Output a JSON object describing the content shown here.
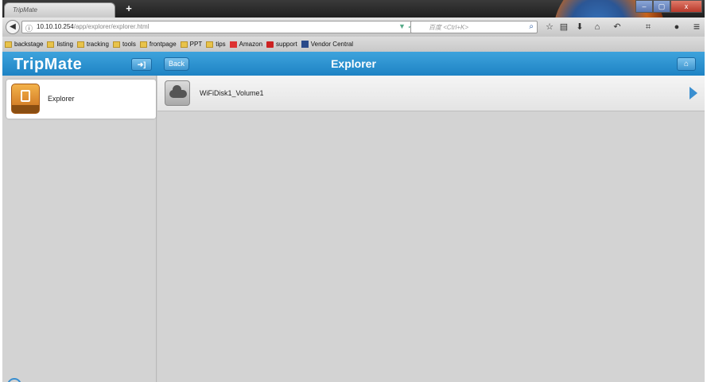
{
  "browser": {
    "tab_title": "TripMate",
    "new_tab_label": "+",
    "url_host": "10.10.10.254",
    "url_path": "/app/explorer/explorer.html",
    "search_placeholder": "百度 <Ctrl+K>",
    "window_buttons": [
      "–",
      "▢",
      "x"
    ]
  },
  "bookmarks": [
    {
      "label": "backstage",
      "icon": "folder-icon"
    },
    {
      "label": "listing",
      "icon": "folder-icon"
    },
    {
      "label": "tracking",
      "icon": "folder-icon"
    },
    {
      "label": "tools",
      "icon": "folder-icon"
    },
    {
      "label": "frontpage",
      "icon": "folder-icon"
    },
    {
      "label": "PPT",
      "icon": "folder-icon"
    },
    {
      "label": "tips",
      "icon": "folder-icon"
    },
    {
      "label": "Amazon",
      "icon": "amazon-icon"
    },
    {
      "label": "support",
      "icon": "support-icon"
    },
    {
      "label": "Vendor Central",
      "icon": "vendor-icon"
    }
  ],
  "app": {
    "logo": "TripMate",
    "back_label": "Back",
    "title": "Explorer",
    "accent_color": "#2a93d2"
  },
  "sidebar": {
    "items": [
      {
        "label": "Explorer",
        "icon": "explorer-icon"
      }
    ]
  },
  "content": {
    "items": [
      {
        "name": "WiFiDisk1_Volume1",
        "icon": "cloud-disk-icon"
      }
    ]
  }
}
